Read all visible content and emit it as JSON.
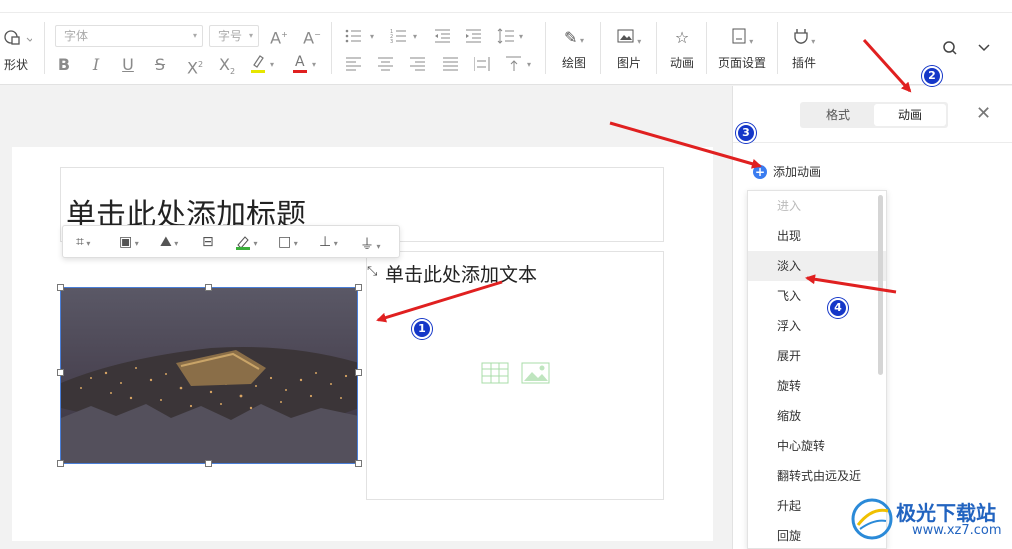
{
  "toolbar": {
    "shape_label": "形状",
    "font_placeholder": "字体",
    "size_placeholder": "字号",
    "draw_label": "绘图",
    "picture_label": "图片",
    "animation_label": "动画",
    "page_setup_label": "页面设置",
    "plugin_label": "插件"
  },
  "panel": {
    "tabs": [
      "格式",
      "动画"
    ],
    "add_animation": "添加动画",
    "effects": [
      "进入",
      "出现",
      "淡入",
      "飞入",
      "浮入",
      "展开",
      "旋转",
      "缩放",
      "中心旋转",
      "翻转式由远及近",
      "升起",
      "回旋"
    ]
  },
  "slide": {
    "title_placeholder": "单击此处添加标题",
    "content_placeholder": "单击此处添加文本"
  },
  "annotations": [
    "1",
    "2",
    "3",
    "4"
  ],
  "watermark": {
    "name": "极光下载站",
    "url": "www.xz7.com"
  },
  "colors": {
    "accent_blue": "#3a7cf0",
    "arrow_red": "#e02020",
    "badge_blue": "#1537c8",
    "selection_border": "#4a7fd8"
  }
}
